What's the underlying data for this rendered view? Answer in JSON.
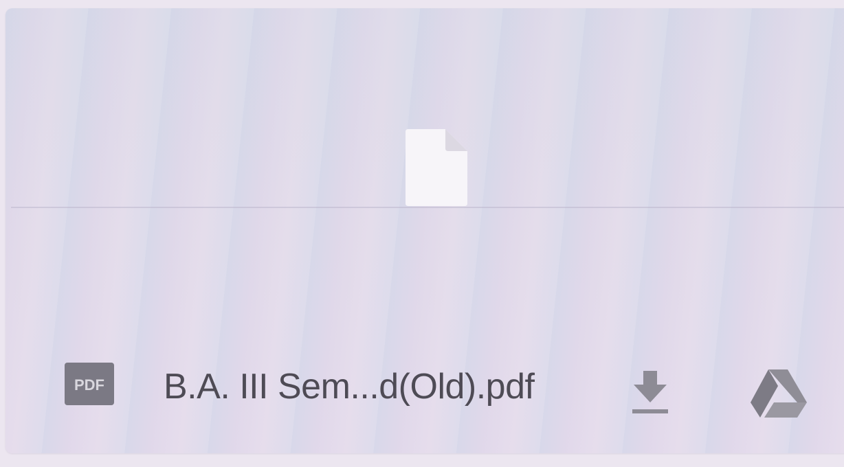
{
  "attachment": {
    "file_name": "B.A. III Sem...d(Old).pdf",
    "file_type_badge": "PDF",
    "preview_icon": "document-icon",
    "type_icon": "pdf-icon",
    "actions": {
      "download_icon": "download-icon",
      "drive_icon": "google-drive-icon"
    }
  },
  "colors": {
    "card_background": "#e0dcea",
    "text": "#4e4b55",
    "icon_gray": "#8a8891",
    "pdf_badge": "#7a7882",
    "document_preview": "#f6f4f8"
  }
}
